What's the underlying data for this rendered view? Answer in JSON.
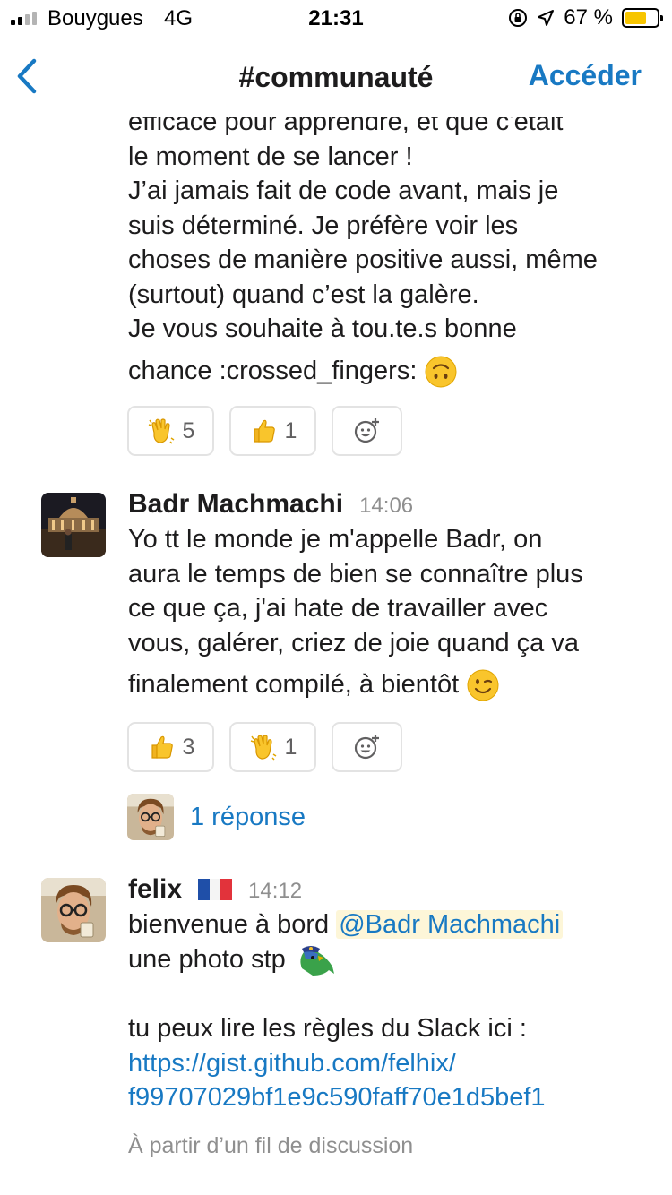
{
  "status_bar": {
    "carrier": "Bouygues",
    "network": "4G",
    "time": "21:31",
    "battery": "67 %",
    "battery_level": 0.67,
    "icons": [
      "signal-icon",
      "orientation-lock-icon",
      "location-arrow-icon",
      "battery-icon"
    ]
  },
  "nav": {
    "back_icon": "chevron-left-icon",
    "title": "#communauté",
    "action": "Accéder"
  },
  "colors": {
    "link": "#1879c3",
    "text": "#1d1c1d",
    "muted": "#8f8f8f",
    "battery": "#f7c500",
    "mention_bg": "#fdf6d8"
  },
  "messages": [
    {
      "continued": true,
      "lines": [
        "efficace pour apprendre, et que c'était",
        "le moment de se lancer !",
        "J’ai jamais fait de code avant, mais je",
        "suis déterminé. Je préfère voir les",
        "choses de manière positive aussi, même",
        "(surtout) quand c’est la galère.",
        "Je vous souhaite à tou.te.s bonne",
        "chance :crossed_fingers:"
      ],
      "trailing_emoji": "upside-down-face-emoji",
      "reactions": [
        {
          "emoji": "waving-hand-emoji",
          "count": "5"
        },
        {
          "emoji": "thumbs-up-emoji",
          "count": "1"
        }
      ],
      "add_reaction_icon": "add-reaction-icon"
    },
    {
      "sender": "Badr Machmachi",
      "time": "14:06",
      "avatar": "pantheon-night-avatar",
      "lines": [
        "Yo tt le monde je m'appelle Badr, on",
        "aura le temps de bien se connaître plus",
        "ce que ça, j'ai hate de travailler avec",
        "vous, galérer, criez de joie quand ça va",
        "finalement compilé, à bientôt"
      ],
      "trailing_emoji": "winking-face-emoji",
      "reactions": [
        {
          "emoji": "thumbs-up-emoji",
          "count": "3"
        },
        {
          "emoji": "waving-hand-emoji",
          "count": "1"
        }
      ],
      "add_reaction_icon": "add-reaction-icon",
      "thread": {
        "avatar": "felix-avatar",
        "label": "1 réponse"
      }
    },
    {
      "sender": "felix",
      "flag": "french-flag-icon",
      "time": "14:12",
      "avatar": "felix-avatar",
      "line1_text": "bienvenue à bord ",
      "mention": "@Badr Machmachi",
      "line2_text": "une photo stp ",
      "custom_emoji": "parrot-police-emoji",
      "line3_text": "tu peux lire les règles du Slack ici :",
      "link_lines": [
        "https://gist.github.com/felhix/",
        "f99707029bf1e9c590faff70e1d5bef1"
      ],
      "thread_note": "À partir d’un fil de discussion"
    }
  ]
}
